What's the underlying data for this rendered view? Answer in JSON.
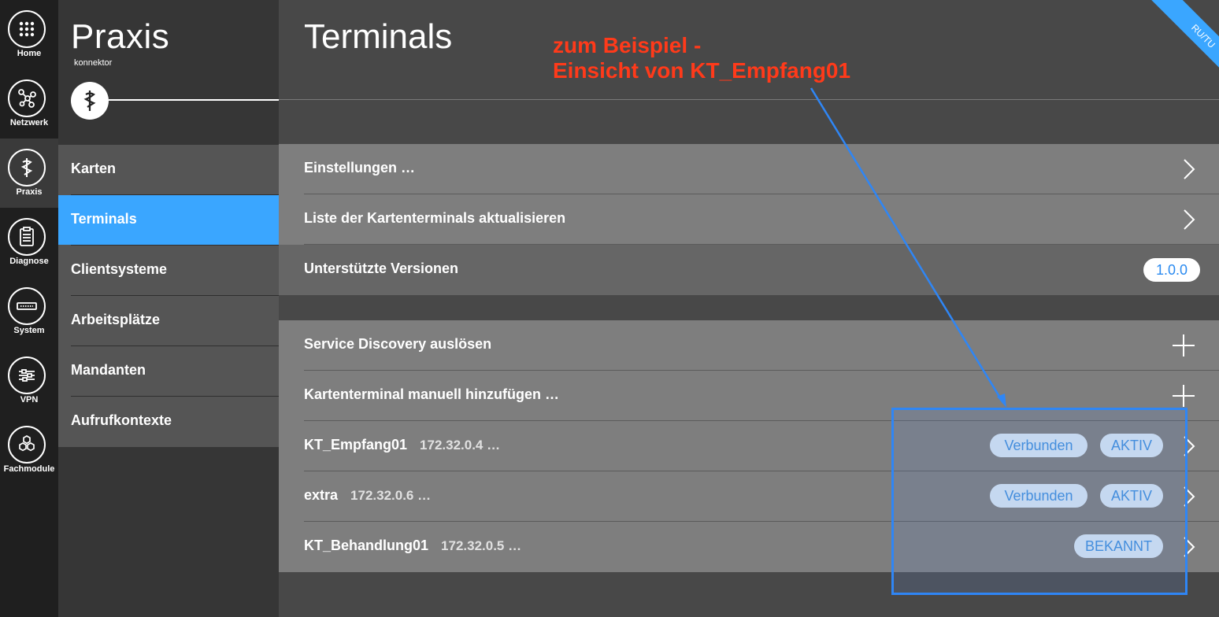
{
  "rail": {
    "items": [
      {
        "label": "Home",
        "icon": "grid-icon"
      },
      {
        "label": "Netzwerk",
        "icon": "network-icon"
      },
      {
        "label": "Praxis",
        "icon": "caduceus-icon"
      },
      {
        "label": "Diagnose",
        "icon": "clipboard-icon"
      },
      {
        "label": "System",
        "icon": "device-icon"
      },
      {
        "label": "VPN",
        "icon": "sliders-icon"
      },
      {
        "label": "Fachmodule",
        "icon": "hexagons-icon"
      }
    ],
    "active": "Praxis"
  },
  "section": {
    "title": "Praxis",
    "subtitle": "konnektor",
    "nav": [
      {
        "label": "Karten"
      },
      {
        "label": "Terminals"
      },
      {
        "label": "Clientsysteme"
      },
      {
        "label": "Arbeitsplätze"
      },
      {
        "label": "Mandanten"
      },
      {
        "label": "Aufrufkontexte"
      }
    ],
    "active": "Terminals"
  },
  "main": {
    "title": "Terminals",
    "settings": {
      "label": "Einstellungen …"
    },
    "refresh": {
      "label": "Liste der Kartenterminals aktualisieren"
    },
    "versions": {
      "label": "Unterstützte Versionen",
      "value": "1.0.0"
    },
    "discovery": {
      "label": "Service Discovery auslösen"
    },
    "add_manual": {
      "label": "Kartenterminal manuell hinzufügen …"
    },
    "terminals": [
      {
        "name": "KT_Empfang01",
        "ip": "172.32.0.4 …",
        "badges": [
          "Verbunden",
          "AKTIV"
        ]
      },
      {
        "name": "extra",
        "ip": "172.32.0.6 …",
        "badges": [
          "Verbunden",
          "AKTIV"
        ]
      },
      {
        "name": "KT_Behandlung01",
        "ip": "172.32.0.5 …",
        "badges": [
          "BEKANNT"
        ]
      }
    ]
  },
  "ribbon": {
    "label": "RU/TU"
  },
  "annotation": {
    "line1": "zum Beispiel -",
    "line2": "Einsicht von KT_Empfang01"
  },
  "colors": {
    "accent": "#3aa6ff",
    "annotation_text": "#ff3a1a",
    "highlight_border": "#2f86f5"
  }
}
